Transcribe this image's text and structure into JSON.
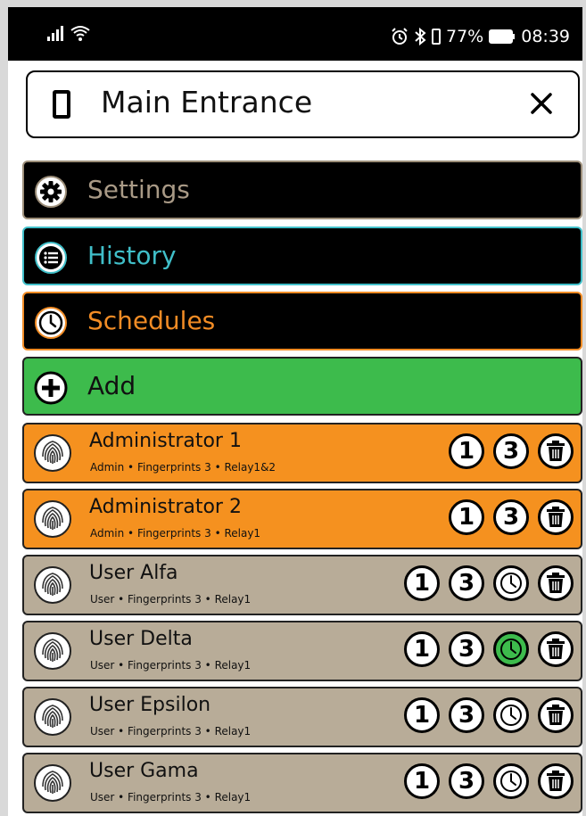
{
  "status_bar": {
    "battery_percent": "77%",
    "time": "08:39"
  },
  "header": {
    "title": "Main Entrance",
    "device_icon": "phone-icon",
    "close_icon": "close-icon"
  },
  "menu": {
    "settings": {
      "label": "Settings",
      "icon": "gear-icon",
      "color": "#a99a86"
    },
    "history": {
      "label": "History",
      "icon": "list-icon",
      "color": "#40bfc9"
    },
    "schedules": {
      "label": "Schedules",
      "icon": "clock-icon",
      "color": "#f28c25"
    },
    "add": {
      "label": "Add",
      "icon": "plus-icon",
      "color": "#3dbb4c"
    }
  },
  "users": [
    {
      "name": "Administrator 1",
      "meta": "Admin • Fingerprints 3 • Relay1&2",
      "badge1": "1",
      "badge2": "3",
      "color": "#f5911f",
      "schedule": false
    },
    {
      "name": "Administrator 2",
      "meta": "Admin • Fingerprints 3 • Relay1",
      "badge1": "1",
      "badge2": "3",
      "color": "#f5911f",
      "schedule": false
    },
    {
      "name": "User Alfa",
      "meta": "User • Fingerprints 3 • Relay1",
      "badge1": "1",
      "badge2": "3",
      "color": "#b8ac98",
      "schedule": true,
      "schedule_active": false
    },
    {
      "name": "User Delta",
      "meta": "User • Fingerprints 3 • Relay1",
      "badge1": "1",
      "badge2": "3",
      "color": "#b8ac98",
      "schedule": true,
      "schedule_active": true
    },
    {
      "name": "User Epsilon",
      "meta": "User • Fingerprints 3 • Relay1",
      "badge1": "1",
      "badge2": "3",
      "color": "#b8ac98",
      "schedule": true,
      "schedule_active": false
    },
    {
      "name": "User Gama",
      "meta": "User • Fingerprints 3 • Relay1",
      "badge1": "1",
      "badge2": "3",
      "color": "#b8ac98",
      "schedule": true,
      "schedule_active": false
    }
  ]
}
